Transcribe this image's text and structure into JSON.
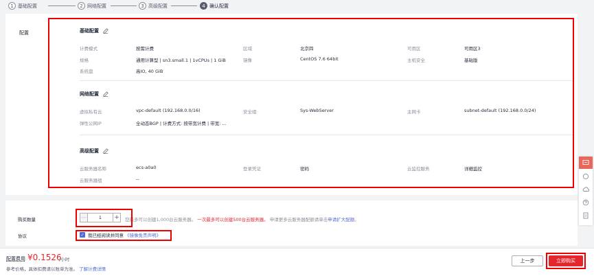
{
  "steps": [
    {
      "num": "1",
      "label": "基础配置"
    },
    {
      "num": "2",
      "label": "网络配置"
    },
    {
      "num": "3",
      "label": "高级配置"
    },
    {
      "num": "4",
      "label": "确认配置"
    }
  ],
  "config": {
    "title": "配置",
    "basic": {
      "title": "基础配置",
      "billing_label": "计费模式",
      "billing_value": "按需计费",
      "region_label": "区域",
      "region_value": "北京四",
      "az_label": "可用区",
      "az_value": "可用区3",
      "spec_label": "规格",
      "spec_value": "通用计算型 | sn3.small.1 | 1vCPUs | 1 GiB",
      "image_label": "镜像",
      "image_value": "CentOS 7.6 64bit",
      "host_sec_label": "主机安全",
      "host_sec_value": "基础版",
      "disk_label": "系统盘",
      "disk_value": "高IO, 40 GiB"
    },
    "network": {
      "title": "网络配置",
      "vpc_label": "虚拟私有云",
      "vpc_value": "vpc-default (192.168.0.0/16)",
      "sg_label": "安全组",
      "sg_value": "Sys-WebServer",
      "nic_label": "主网卡",
      "nic_value": "subnet-default (192.168.0.0/24)",
      "eip_label": "弹性公网IP",
      "eip_value": "全动态BGP | 计费方式: 按带宽计费 | 带宽: ..."
    },
    "advanced": {
      "title": "高级配置",
      "name_label": "云服务器名称",
      "name_value": "ecs-a0a0",
      "login_label": "登录凭证",
      "login_value": "密码",
      "monitor_label": "云监控服务",
      "monitor_value": "详细监控",
      "group_label": "云服务器组",
      "group_value": "--"
    }
  },
  "purchase": {
    "qty_label": "购买数量",
    "qty_value": "1",
    "minus": "—",
    "plus": "+",
    "hint_prefix": "您最多可以创建1,000台云服务器。",
    "hint_red": "一次最多可以创建500台云服务器。",
    "hint_mid": "申请更多云服务器配额请单击",
    "hint_link": "申请扩大配额",
    "hint_end": "。",
    "protocol_label": "协议",
    "agree_text": "我已经阅读并同意",
    "agree_link": "《镜像免责声明》",
    "check": "✓"
  },
  "footer": {
    "fee_label": "配置费用",
    "price": "¥0.1526",
    "unit": "/小时",
    "note": "参考价格，具体扣费请以账单为准。",
    "note_link": "了解计费详情",
    "prev": "上一步",
    "buy": "立即购买"
  },
  "colors": {
    "accent": "#526ecc",
    "red": "#e5252d",
    "highlight": "#ee0000"
  }
}
